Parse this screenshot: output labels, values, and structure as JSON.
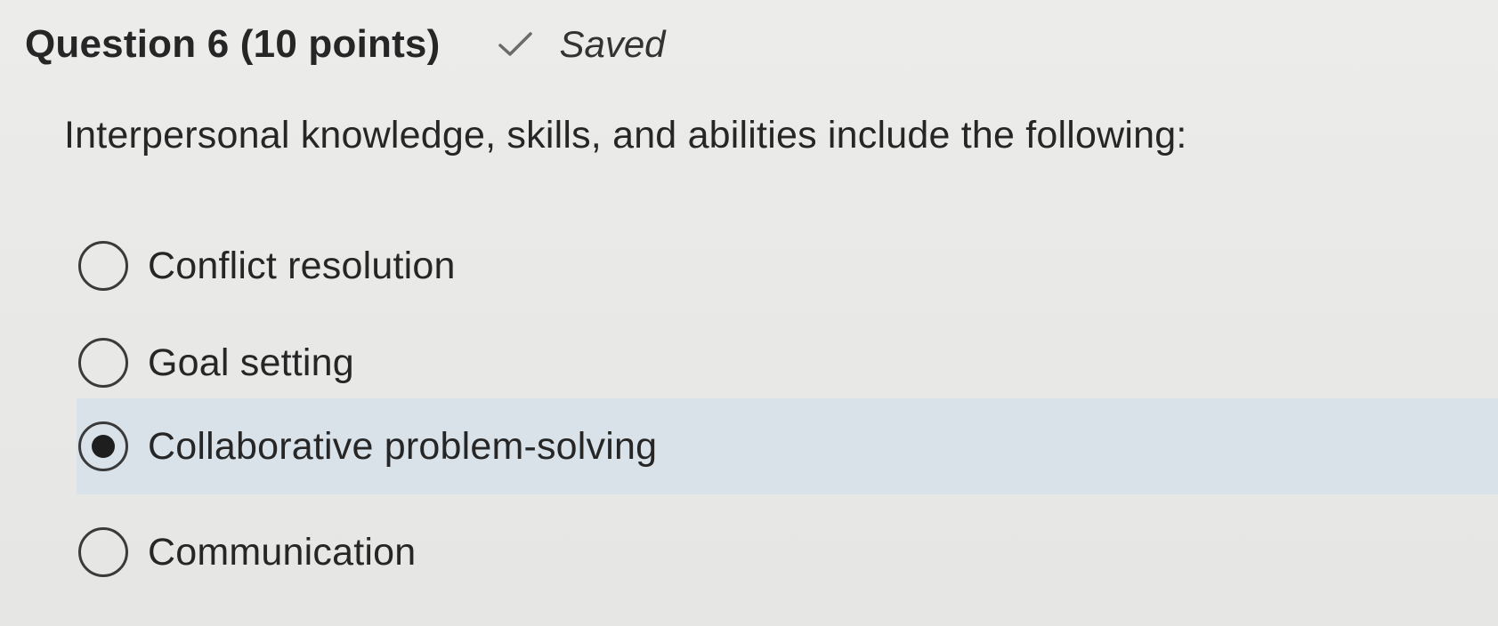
{
  "question": {
    "title": "Question 6 (10 points)",
    "status": "Saved",
    "status_icon": "check-icon",
    "prompt": "Interpersonal knowledge, skills, and abilities include the following:"
  },
  "options": [
    {
      "label": "Conflict resolution",
      "selected": false
    },
    {
      "label": "Goal setting",
      "selected": false
    },
    {
      "label": "Collaborative problem-solving",
      "selected": true
    },
    {
      "label": "Communication",
      "selected": false
    }
  ],
  "colors": {
    "background": "#e9e9e7",
    "selected_row": "#d9e2e8",
    "text": "#262626"
  }
}
